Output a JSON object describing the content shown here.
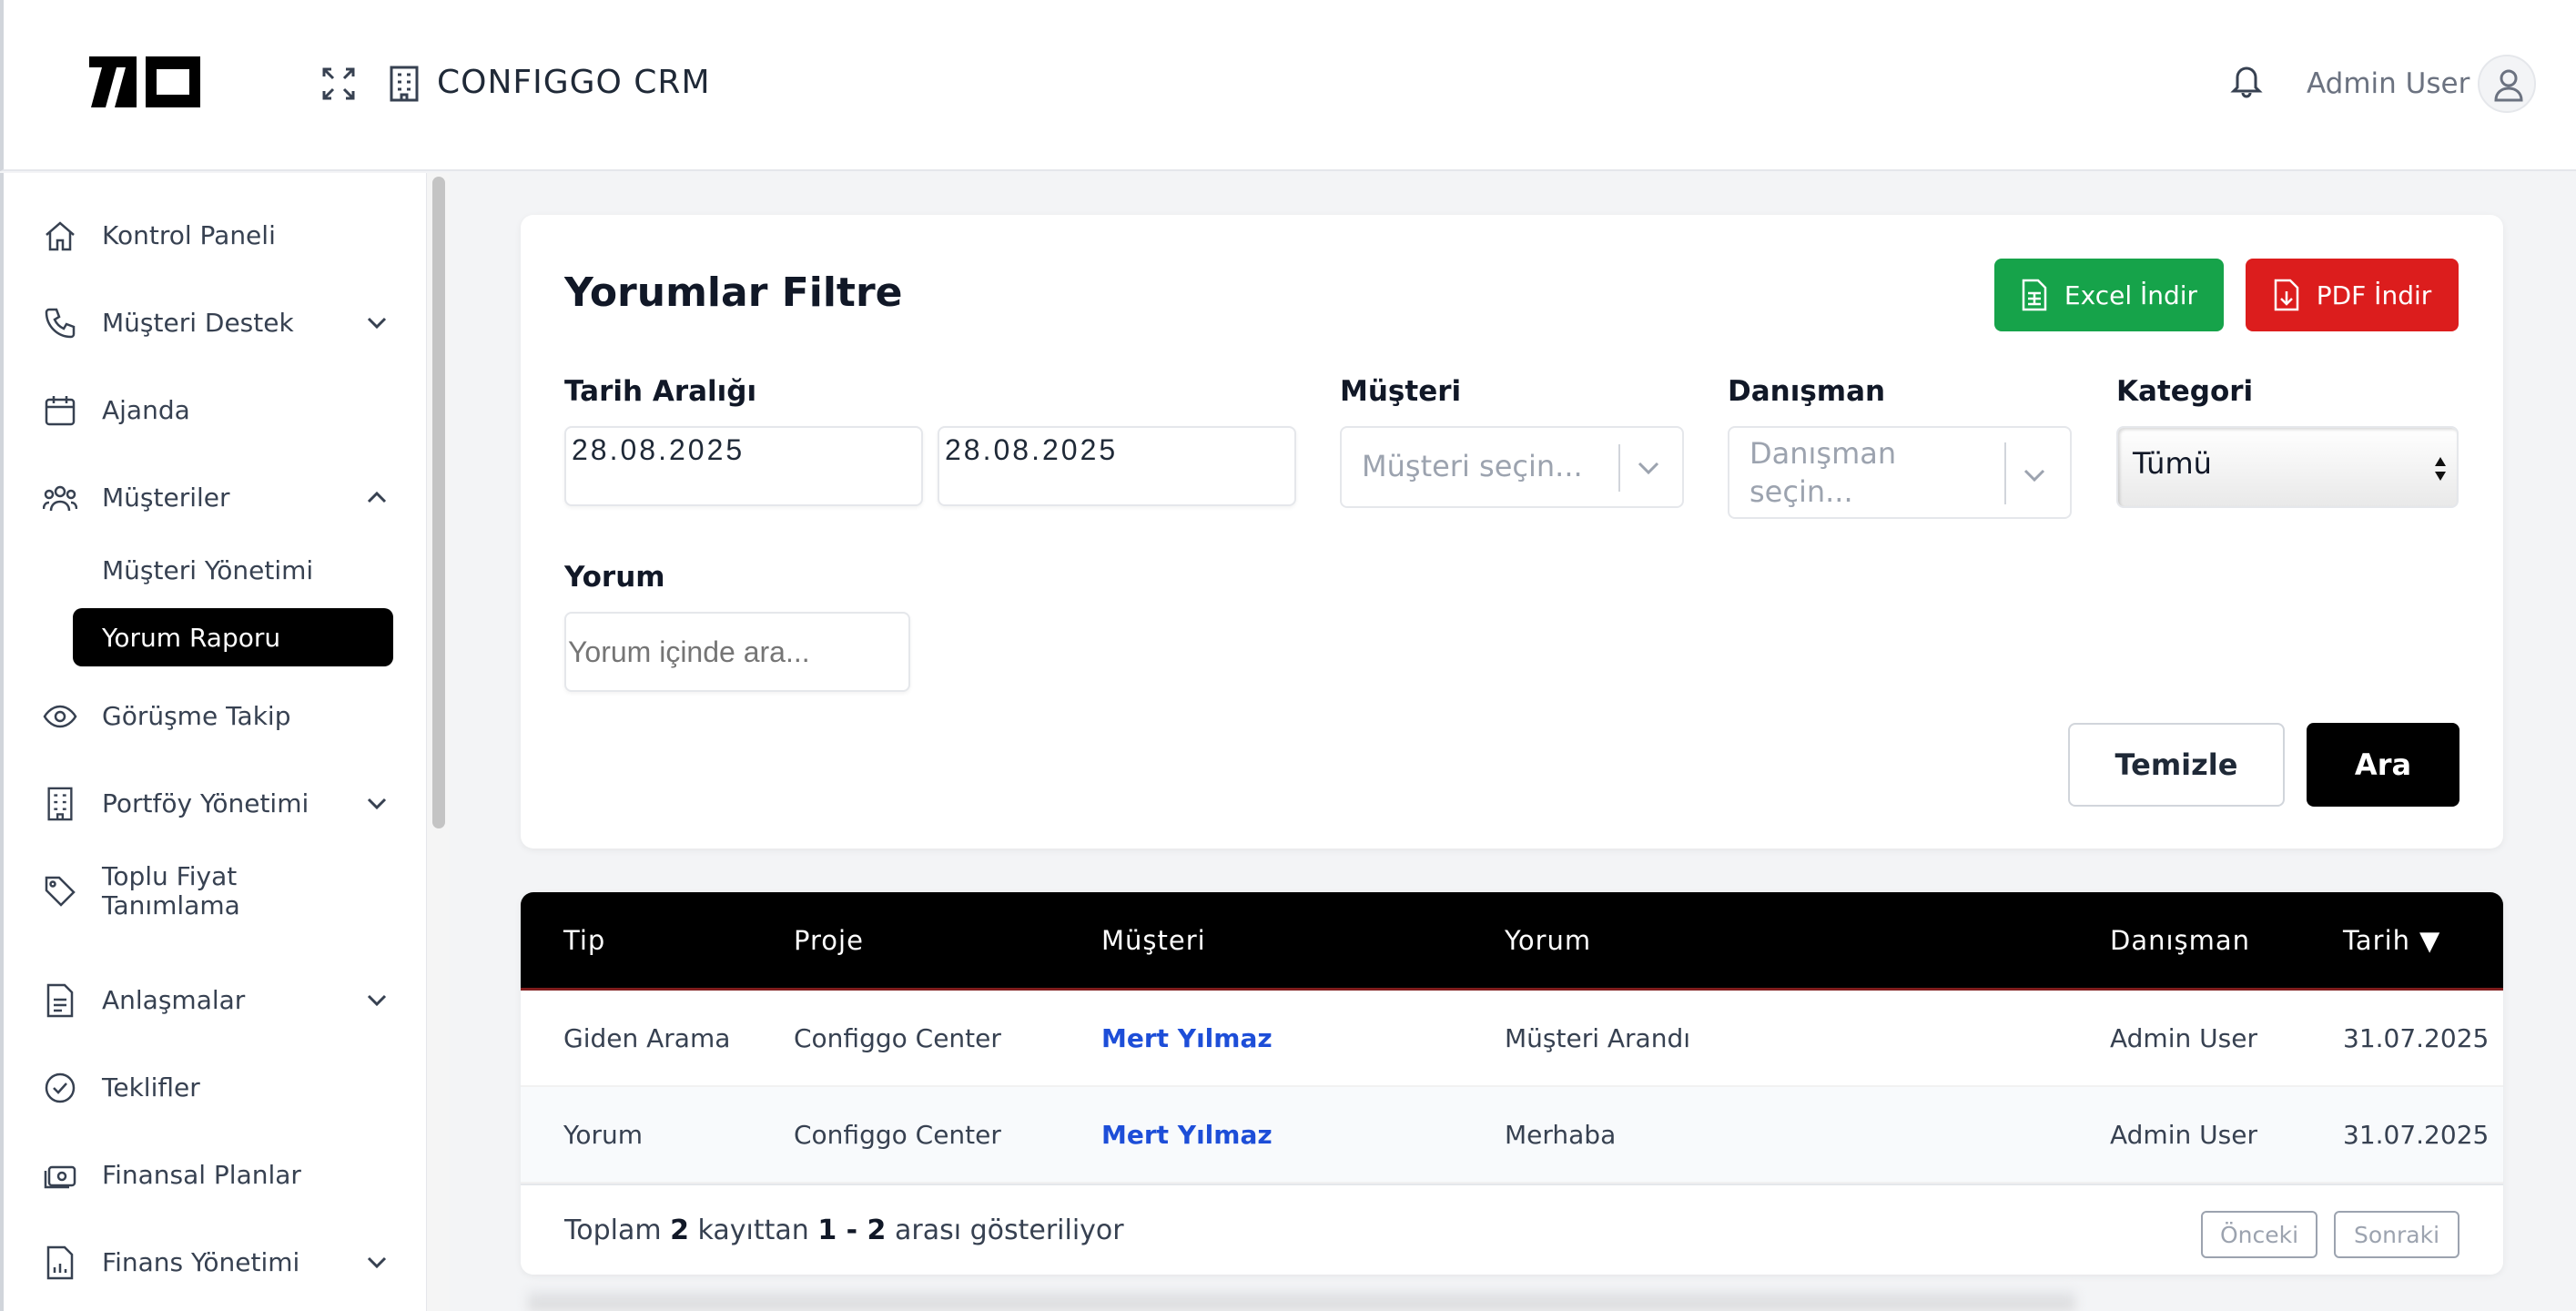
{
  "header": {
    "app_title": "CONFIGGO  CRM",
    "user_name": "Admin User",
    "icons": [
      "logo",
      "expand-icon",
      "building-icon",
      "bell-icon",
      "user-icon"
    ]
  },
  "sidebar": {
    "items": [
      {
        "label": "Kontrol Paneli",
        "icon": "home-icon"
      },
      {
        "label": "Müşteri Destek",
        "icon": "phone-icon",
        "expandable": true
      },
      {
        "label": "Ajanda",
        "icon": "calendar-icon"
      },
      {
        "label": "Müşteriler",
        "icon": "users-icon",
        "expanded": true
      },
      {
        "label": "Görüşme Takip",
        "icon": "eye-icon"
      },
      {
        "label": "Portföy Yönetimi",
        "icon": "building-icon",
        "expandable": true
      },
      {
        "label": "Toplu Fiyat\nTanımlama",
        "icon": "tag-icon"
      },
      {
        "label": "Anlaşmalar",
        "icon": "document-icon",
        "expandable": true
      },
      {
        "label": "Teklifler",
        "icon": "check-circle-icon"
      },
      {
        "label": "Finansal Planlar",
        "icon": "money-icon"
      },
      {
        "label": "Finans Yönetimi",
        "icon": "chart-icon",
        "expandable": true
      }
    ],
    "sub_items": [
      {
        "label": "Müşteri Yönetimi",
        "active": false
      },
      {
        "label": "Yorum Raporu",
        "active": true
      }
    ]
  },
  "filter": {
    "title": "Yorumlar Filtre",
    "excel_label": "Excel İndir",
    "pdf_label": "PDF İndir",
    "date_label": "Tarih Aralığı",
    "date_from": "28.08.2025",
    "date_to": "28.08.2025",
    "customer_label": "Müşteri",
    "customer_placeholder": "Müşteri seçin...",
    "consultant_label": "Danışman",
    "consultant_placeholder_line1": "Danışman",
    "consultant_placeholder_line2": "seçin...",
    "category_label": "Kategori",
    "category_value": "Tümü",
    "comment_label": "Yorum",
    "comment_placeholder": "Yorum içinde ara...",
    "clear_label": "Temizle",
    "search_label": "Ara"
  },
  "table": {
    "columns": [
      "Tip",
      "Proje",
      "Müşteri",
      "Yorum",
      "Danışman",
      "Tarih"
    ],
    "sort_indicator": "▼",
    "rows": [
      [
        "Giden Arama",
        "Configgo Center",
        "Mert Yılmaz",
        "Müşteri Arandı",
        "Admin User",
        "31.07.2025"
      ],
      [
        "Yorum",
        "Configgo Center",
        "Mert Yılmaz",
        "Merhaba",
        "Admin User",
        "31.07.2025"
      ]
    ],
    "footer": {
      "prefix": "Toplam",
      "total": "2",
      "middle": "kayıttan",
      "range": "1 - 2",
      "suffix": "arası gösteriliyor"
    },
    "prev_label": "Önceki",
    "next_label": "Sonraki"
  }
}
